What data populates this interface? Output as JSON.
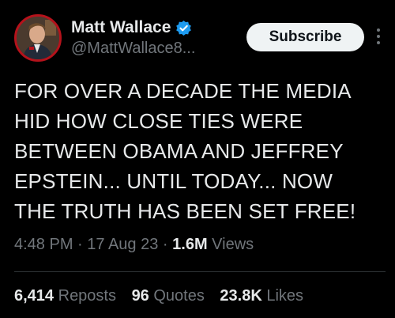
{
  "author": {
    "display_name": "Matt Wallace",
    "handle": "@MattWallace8...",
    "verified": true,
    "verified_color": "#1d9bf0"
  },
  "actions": {
    "subscribe_label": "Subscribe",
    "more_icon": "more-vertical-icon"
  },
  "tweet": {
    "text": "FOR OVER A DECADE THE MEDIA\nHID HOW CLOSE TIES WERE\nBETWEEN OBAMA AND JEFFREY\nEPSTEIN... UNTIL TODAY... NOW\nTHE TRUTH HAS BEEN SET FREE!"
  },
  "meta": {
    "time": "4:48 PM",
    "separator": " · ",
    "date": "17 Aug 23",
    "views_count": "1.6M",
    "views_label": " Views"
  },
  "stats": {
    "reposts_count": "6,414",
    "reposts_label": " Reposts",
    "quotes_count": "96",
    "quotes_label": " Quotes",
    "likes_count": "23.8K",
    "likes_label": " Likes"
  },
  "colors": {
    "background": "#000000",
    "primary_text": "#e7e9ea",
    "secondary_text": "#71767b",
    "divider": "#2f3336",
    "button_bg": "#eff3f4"
  }
}
